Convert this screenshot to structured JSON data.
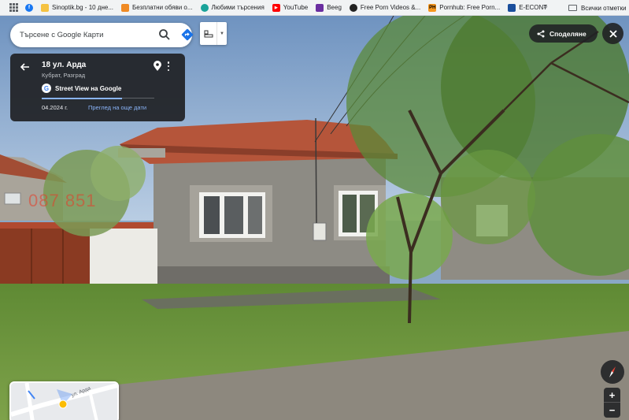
{
  "bookmarks": {
    "items": [
      {
        "label": "",
        "icon": "facebook-icon",
        "color": "#1877f2"
      },
      {
        "label": "Sinoptik.bg - 10 дне...",
        "icon": "sinoptik-icon",
        "color": "#f5c242"
      },
      {
        "label": "Безплатни обяви о...",
        "icon": "olx-icon",
        "color": "#f08a24"
      },
      {
        "label": "Любими търсения",
        "icon": "imot-icon",
        "color": "#1aa39a"
      },
      {
        "label": "YouTube",
        "icon": "youtube-icon",
        "color": "#ff0000"
      },
      {
        "label": "Beeg",
        "icon": "beeg-icon",
        "color": "#6a2ea0"
      },
      {
        "label": "Free Porn Videos &...",
        "icon": "site-icon",
        "color": "#222222"
      },
      {
        "label": "Pornhub: Free Porn...",
        "icon": "ph-icon",
        "color": "#f7971d"
      },
      {
        "label": "E-ECONT",
        "icon": "econt-icon",
        "color": "#1a4e9c"
      }
    ],
    "more": "»",
    "all_label": "Всички отметки"
  },
  "search": {
    "placeholder": "Търсене с Google Карти"
  },
  "infocard": {
    "title": "18 ул. Арда",
    "subtitle": "Кубрат, Разград",
    "sv_label": "Street View на Google",
    "date": "04.2024 г.",
    "more_dates": "Преглед на още дати"
  },
  "share_label": "Споделяне",
  "watermark": "087 851",
  "minimap": {
    "street": "ул. Арда"
  },
  "zoom": {
    "in": "+",
    "out": "−"
  },
  "colors": {
    "accent": "#8ab4f8",
    "panel": "#202124",
    "roof": "#b5553a",
    "wall": "#8c8a83"
  }
}
